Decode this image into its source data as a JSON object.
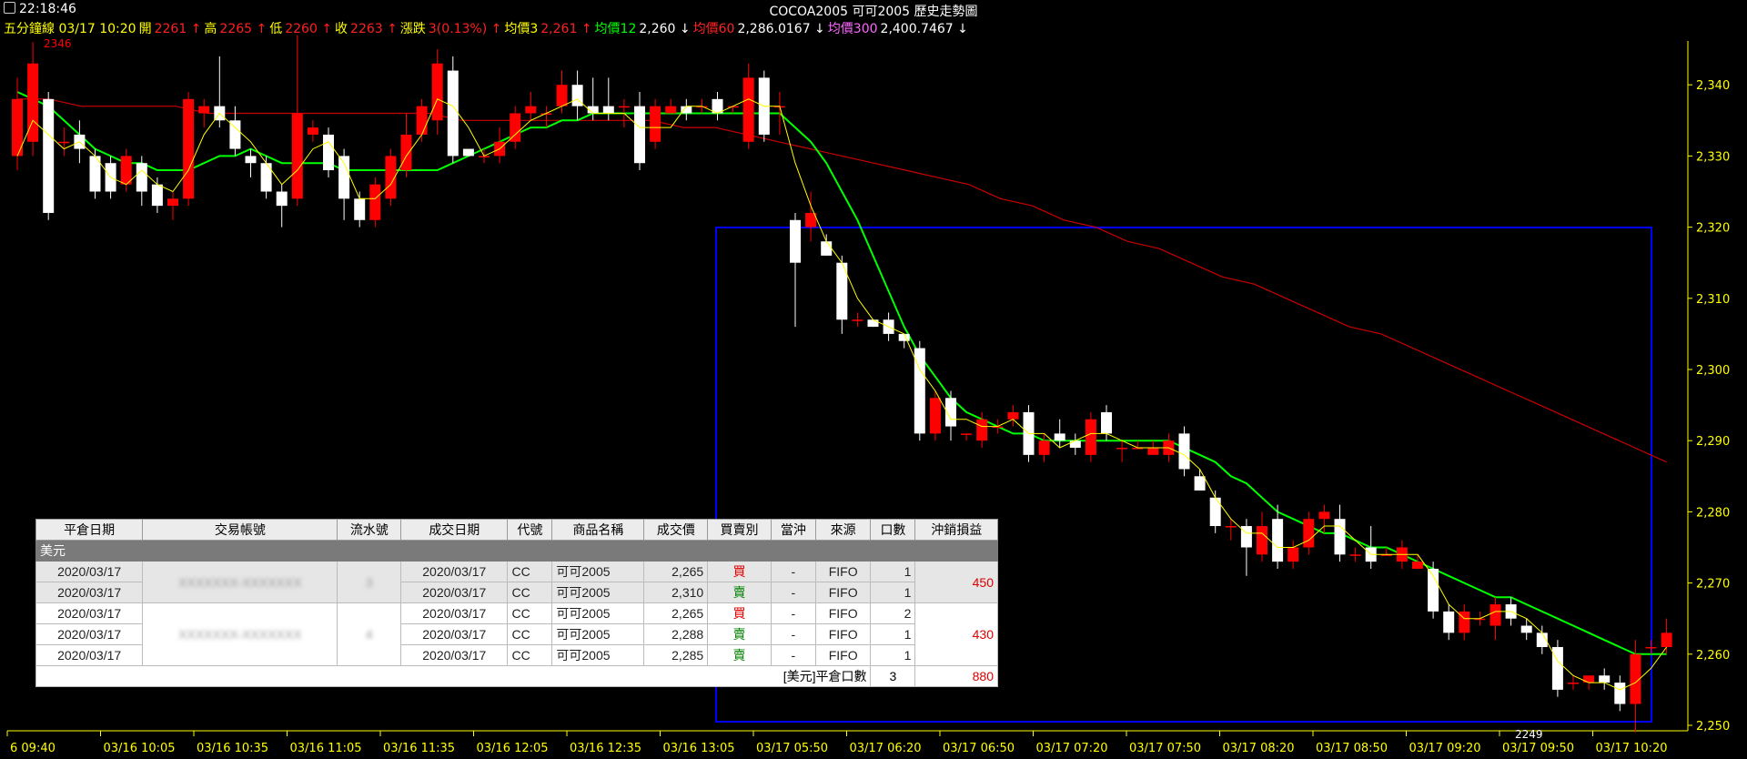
{
  "header": {
    "time": "22:18:46",
    "title": "COCOA2005 可可2005  歷史走勢圖",
    "info": [
      {
        "t": "五分鐘線 03/17 10:20",
        "c": "y"
      },
      {
        "t": "開",
        "c": "y"
      },
      {
        "t": "2261 ↑",
        "c": "r"
      },
      {
        "t": "高",
        "c": "y"
      },
      {
        "t": "2265 ↑",
        "c": "r"
      },
      {
        "t": "低",
        "c": "y"
      },
      {
        "t": "2260 ↑",
        "c": "r"
      },
      {
        "t": "收",
        "c": "y"
      },
      {
        "t": "2263 ↑",
        "c": "r"
      },
      {
        "t": "漲跌",
        "c": "y"
      },
      {
        "t": "3(0.13%) ↑",
        "c": "r"
      },
      {
        "t": "均價3",
        "c": "y"
      },
      {
        "t": "2,261 ↑",
        "c": "r"
      },
      {
        "t": "均價12",
        "c": "g"
      },
      {
        "t": "2,260 ↓",
        "c": "w"
      },
      {
        "t": "均價60",
        "c": "r"
      },
      {
        "t": "2,286.0167 ↓",
        "c": "w"
      },
      {
        "t": "均價300",
        "c": "m"
      },
      {
        "t": "2,400.7467 ↓",
        "c": "w"
      }
    ]
  },
  "chart_data": {
    "type": "candlestick",
    "ylim": [
      2248,
      2342
    ],
    "yticks": [
      "2,250",
      "2,260",
      "2,270",
      "2,280",
      "2,290",
      "2,300",
      "2,310",
      "2,320",
      "2,330",
      "2,340"
    ],
    "xticks": [
      "6 09:40",
      "03/16 10:05",
      "03/16 10:35",
      "03/16 11:05",
      "03/16 11:35",
      "03/16 12:05",
      "03/16 12:35",
      "03/16 13:05",
      "03/17 05:50",
      "03/17 06:20",
      "03/17 06:50",
      "03/17 07:20",
      "03/17 07:50",
      "03/17 08:20",
      "03/17 08:50",
      "03/17 09:20",
      "03/17 09:50",
      "03/17 10:20"
    ],
    "annotations": {
      "high_label": "2346",
      "low_label": "2249"
    },
    "colors": {
      "up": "#ff0000",
      "down": "#ffffff",
      "ma3": "#ffff00",
      "ma12": "#00ff00",
      "ma60": "#cc0000",
      "box": "#0000ff",
      "axis": "#ffff00"
    },
    "candles": [
      [
        2330,
        2338,
        2341,
        2328
      ],
      [
        2332,
        2343,
        2346,
        2330
      ],
      [
        2338,
        2322,
        2339,
        2321
      ],
      [
        2332,
        2332,
        2334,
        2330
      ],
      [
        2333,
        2331,
        2335,
        2329
      ],
      [
        2330,
        2325,
        2331,
        2324
      ],
      [
        2329,
        2325,
        2330,
        2324
      ],
      [
        2326,
        2330,
        2331,
        2325
      ],
      [
        2329,
        2325,
        2330,
        2323
      ],
      [
        2326,
        2323,
        2327,
        2322
      ],
      [
        2323,
        2324,
        2325,
        2321
      ],
      [
        2324,
        2338,
        2339,
        2323
      ],
      [
        2336,
        2337,
        2338,
        2334
      ],
      [
        2337,
        2335,
        2344,
        2334
      ],
      [
        2335,
        2331,
        2337,
        2330
      ],
      [
        2330,
        2329,
        2331,
        2327
      ],
      [
        2329,
        2325,
        2330,
        2324
      ],
      [
        2325,
        2323,
        2326,
        2320
      ],
      [
        2324,
        2336,
        2347,
        2323
      ],
      [
        2333,
        2334,
        2335,
        2332
      ],
      [
        2333,
        2328,
        2334,
        2327
      ],
      [
        2330,
        2324,
        2331,
        2321
      ],
      [
        2324,
        2321,
        2325,
        2320
      ],
      [
        2321,
        2326,
        2327,
        2320
      ],
      [
        2324,
        2330,
        2331,
        2323
      ],
      [
        2328,
        2333,
        2336,
        2327
      ],
      [
        2333,
        2337,
        2338,
        2332
      ],
      [
        2335,
        2343,
        2345,
        2333
      ],
      [
        2342,
        2330,
        2344,
        2329
      ],
      [
        2331,
        2330,
        2331,
        2330
      ],
      [
        2330,
        2330,
        2331,
        2329
      ],
      [
        2330,
        2332,
        2334,
        2329
      ],
      [
        2332,
        2336,
        2337,
        2331
      ],
      [
        2336,
        2337,
        2339,
        2335
      ],
      [
        2336,
        2336,
        2337,
        2334
      ],
      [
        2337,
        2340,
        2342,
        2336
      ],
      [
        2340,
        2337,
        2342,
        2335
      ],
      [
        2337,
        2336,
        2341,
        2335
      ],
      [
        2337,
        2336,
        2341,
        2335
      ],
      [
        2337,
        2337,
        2338,
        2334
      ],
      [
        2337,
        2329,
        2339,
        2328
      ],
      [
        2332,
        2337,
        2338,
        2331
      ],
      [
        2336,
        2337,
        2338,
        2336
      ],
      [
        2337,
        2336,
        2338,
        2335
      ],
      [
        2337,
        2337,
        2338,
        2336
      ],
      [
        2338,
        2336,
        2339,
        2335
      ],
      [
        2337,
        2337,
        2337,
        2336
      ],
      [
        2332,
        2341,
        2343,
        2331
      ],
      [
        2341,
        2333,
        2342,
        2332
      ],
      [
        2337,
        2337,
        2339,
        2333
      ],
      [
        2321,
        2315,
        2322,
        2306
      ],
      [
        2320,
        2322,
        2325,
        2318
      ],
      [
        2318,
        2316,
        2319,
        2316
      ],
      [
        2315,
        2307,
        2316,
        2305
      ],
      [
        2307,
        2307,
        2308,
        2306
      ],
      [
        2307,
        2306,
        2307,
        2306
      ],
      [
        2307,
        2305,
        2308,
        2304
      ],
      [
        2305,
        2304,
        2305,
        2303
      ],
      [
        2303,
        2291,
        2304,
        2290
      ],
      [
        2291,
        2296,
        2297,
        2290
      ],
      [
        2296,
        2292,
        2297,
        2290
      ],
      [
        2291,
        2291,
        2291,
        2290
      ],
      [
        2290,
        2293,
        2294,
        2289
      ],
      [
        2292,
        2292,
        2293,
        2291
      ],
      [
        2293,
        2294,
        2295,
        2292
      ],
      [
        2294,
        2288,
        2295,
        2287
      ],
      [
        2288,
        2290,
        2291,
        2287
      ],
      [
        2291,
        2290,
        2293,
        2289
      ],
      [
        2290,
        2289,
        2291,
        2288
      ],
      [
        2288,
        2293,
        2294,
        2287
      ],
      [
        2294,
        2291,
        2295,
        2290
      ],
      [
        2289,
        2289,
        2290,
        2287
      ],
      [
        2289,
        2289,
        2290,
        2289
      ],
      [
        2288,
        2289,
        2290,
        2288
      ],
      [
        2288,
        2290,
        2291,
        2287
      ],
      [
        2291,
        2286,
        2292,
        2285
      ],
      [
        2285,
        2283,
        2286,
        2283
      ],
      [
        2282,
        2278,
        2283,
        2277
      ],
      [
        2278,
        2278,
        2279,
        2276
      ],
      [
        2278,
        2275,
        2279,
        2271
      ],
      [
        2274,
        2278,
        2280,
        2273
      ],
      [
        2279,
        2273,
        2281,
        2272
      ],
      [
        2273,
        2275,
        2276,
        2272
      ],
      [
        2275,
        2279,
        2280,
        2274
      ],
      [
        2279,
        2280,
        2281,
        2277
      ],
      [
        2279,
        2274,
        2281,
        2273
      ],
      [
        2274,
        2274,
        2275,
        2273
      ],
      [
        2275,
        2273,
        2278,
        2272
      ],
      [
        2274,
        2274,
        2275,
        2274
      ],
      [
        2273,
        2275,
        2276,
        2272
      ],
      [
        2272,
        2273,
        2274,
        2272
      ],
      [
        2272,
        2266,
        2273,
        2265
      ],
      [
        2266,
        2263,
        2267,
        2262
      ],
      [
        2263,
        2266,
        2267,
        2262
      ],
      [
        2265,
        2265,
        2266,
        2264
      ],
      [
        2264,
        2267,
        2268,
        2262
      ],
      [
        2267,
        2265,
        2268,
        2264
      ],
      [
        2264,
        2263,
        2265,
        2262
      ],
      [
        2263,
        2261,
        2264,
        2260
      ],
      [
        2261,
        2255,
        2262,
        2254
      ],
      [
        2256,
        2256,
        2257,
        2255
      ],
      [
        2256,
        2257,
        2257,
        2255
      ],
      [
        2257,
        2256,
        2258,
        2255
      ],
      [
        2256,
        2253,
        2257,
        2252
      ],
      [
        2253,
        2260,
        2262,
        2249
      ],
      [
        2261,
        2261,
        2262,
        2260
      ],
      [
        2261,
        2263,
        2265,
        2260
      ]
    ],
    "ma3": [
      2330,
      2335,
      2333,
      2331,
      2332,
      2330,
      2327,
      2326,
      2328,
      2326,
      2325,
      2328,
      2333,
      2336,
      2334,
      2332,
      2329,
      2326,
      2328,
      2331,
      2332,
      2329,
      2324,
      2324,
      2326,
      2330,
      2333,
      2338,
      2337,
      2334,
      2330,
      2331,
      2333,
      2335,
      2336,
      2337,
      2338,
      2336,
      2336,
      2336,
      2334,
      2334,
      2334,
      2337,
      2337,
      2336,
      2337,
      2338,
      2337,
      2337,
      2329,
      2323,
      2318,
      2315,
      2310,
      2307,
      2306,
      2305,
      2300,
      2297,
      2293,
      2293,
      2292,
      2292,
      2293,
      2291,
      2291,
      2289,
      2290,
      2291,
      2291,
      2290,
      2289,
      2289,
      2289,
      2288,
      2286,
      2282,
      2279,
      2277,
      2277,
      2275,
      2275,
      2276,
      2278,
      2278,
      2276,
      2274,
      2274,
      2274,
      2274,
      2271,
      2267,
      2265,
      2265,
      2266,
      2266,
      2265,
      2263,
      2259,
      2257,
      2256,
      2256,
      2255,
      2256,
      2258,
      2261
    ],
    "ma12": [
      2339,
      2338,
      2337,
      2335,
      2333,
      2331,
      2330,
      2329,
      2329,
      2328,
      2328,
      2328,
      2329,
      2330,
      2330,
      2331,
      2330,
      2329,
      2329,
      2329,
      2329,
      2328,
      2328,
      2328,
      2328,
      2328,
      2328,
      2328,
      2329,
      2330,
      2331,
      2332,
      2333,
      2334,
      2334,
      2335,
      2335,
      2336,
      2336,
      2336,
      2336,
      2336,
      2336,
      2336,
      2336,
      2336,
      2336,
      2336,
      2336,
      2336,
      2334,
      2332,
      2329,
      2325,
      2321,
      2316,
      2311,
      2306,
      2302,
      2299,
      2296,
      2294,
      2293,
      2292,
      2291,
      2291,
      2290,
      2290,
      2290,
      2290,
      2290,
      2290,
      2290,
      2290,
      2290,
      2289,
      2288,
      2287,
      2285,
      2284,
      2282,
      2280,
      2279,
      2278,
      2277,
      2277,
      2276,
      2275,
      2275,
      2274,
      2273,
      2272,
      2271,
      2270,
      2269,
      2268,
      2268,
      2267,
      2266,
      2265,
      2264,
      2263,
      2262,
      2261,
      2260,
      2260,
      2260
    ],
    "ma60": [
      2338,
      2338,
      2337,
      2337,
      2337,
      2337,
      2336,
      2336,
      2336,
      2336,
      2336,
      2336,
      2336,
      2336,
      2335,
      2335,
      2335,
      2335,
      2335,
      2335,
      2335,
      2334,
      2334,
      2333,
      2332,
      2331,
      2330,
      2329,
      2328,
      2327,
      2326,
      2324,
      2323,
      2321,
      2320,
      2318,
      2317,
      2315,
      2313,
      2312,
      2310,
      2308,
      2306,
      2305,
      2303,
      2301,
      2299,
      2297,
      2295,
      2293,
      2291,
      2289,
      2287
    ]
  },
  "table": {
    "headers": [
      "平倉日期",
      "交易帳號",
      "流水號",
      "成交日期",
      "代號",
      "商品名稱",
      "成交價",
      "買賣別",
      "當沖",
      "來源",
      "口數",
      "沖銷損益"
    ],
    "group": "美元",
    "rows": [
      [
        "2020/03/17",
        "XXXXXXX-XXXXXXX",
        "3",
        "2020/03/17",
        "CC",
        "可可2005",
        "2,265",
        "買",
        "-",
        "FIFO",
        "1",
        "450"
      ],
      [
        "2020/03/17",
        "",
        "",
        "2020/03/17",
        "CC",
        "可可2005",
        "2,310",
        "賣",
        "-",
        "FIFO",
        "1",
        ""
      ],
      [
        "2020/03/17",
        "XXXXXXX-XXXXXXX",
        "4",
        "2020/03/17",
        "CC",
        "可可2005",
        "2,265",
        "買",
        "-",
        "FIFO",
        "2",
        "430"
      ],
      [
        "2020/03/17",
        "",
        "",
        "2020/03/17",
        "CC",
        "可可2005",
        "2,288",
        "賣",
        "-",
        "FIFO",
        "1",
        ""
      ],
      [
        "2020/03/17",
        "",
        "",
        "2020/03/17",
        "CC",
        "可可2005",
        "2,285",
        "賣",
        "-",
        "FIFO",
        "1",
        ""
      ]
    ],
    "summary": {
      "label": "[美元]平倉口數",
      "count": "3",
      "total": "880"
    }
  }
}
